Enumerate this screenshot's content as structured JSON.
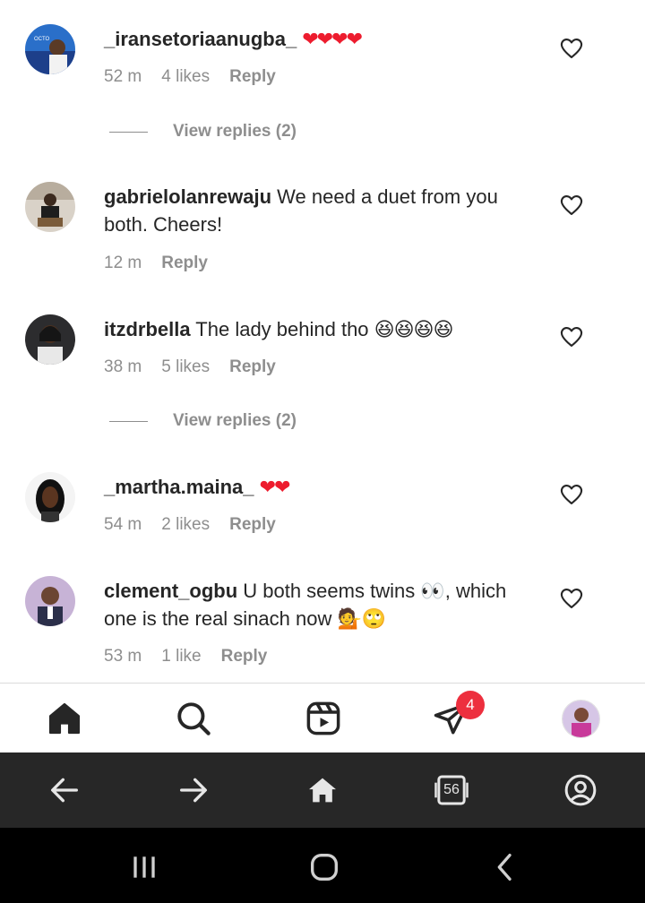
{
  "comments": [
    {
      "username": "_iransetoriaanugba_",
      "text": "",
      "emoji": "❤❤❤❤",
      "time": "52 m",
      "likes": "4 likes",
      "reply_label": "Reply",
      "view_replies": "View replies (2)"
    },
    {
      "username": "gabrielolanrewaju",
      "text": " We need a duet from you both. Cheers!",
      "emoji": "",
      "time": "12 m",
      "likes": "",
      "reply_label": "Reply",
      "view_replies": ""
    },
    {
      "username": "itzdrbella",
      "text": " The lady behind tho ",
      "emoji": "😆😆😆😆",
      "time": "38 m",
      "likes": "5 likes",
      "reply_label": "Reply",
      "view_replies": "View replies (2)"
    },
    {
      "username": "_martha.maina_",
      "text": "",
      "emoji": "❤❤",
      "time": "54 m",
      "likes": "2 likes",
      "reply_label": "Reply",
      "view_replies": ""
    },
    {
      "username": "clement_ogbu",
      "text": " U both seems twins 👀, which one is the real sinach now 💁🙄",
      "emoji": "",
      "time": "53 m",
      "likes": "1 like",
      "reply_label": "Reply",
      "view_replies": ""
    }
  ],
  "tabbar": {
    "items": [
      "home-icon",
      "search-icon",
      "reels-icon",
      "direct-messages-icon",
      "profile-avatar"
    ],
    "notification_count": "4",
    "badge_color": "#ed2f3e"
  },
  "browser": {
    "items": [
      "back-arrow-icon",
      "forward-arrow-icon",
      "home-icon",
      "tabs-icon",
      "account-icon"
    ],
    "tab_count": "56",
    "bar_color": "#272727"
  },
  "system_nav": {
    "items": [
      "recent-apps-icon",
      "home-circle-icon",
      "back-chevron-icon"
    ]
  },
  "colors": {
    "text": "#262626",
    "secondary": "#8e8e8e",
    "heart": "#ed1c2e"
  }
}
